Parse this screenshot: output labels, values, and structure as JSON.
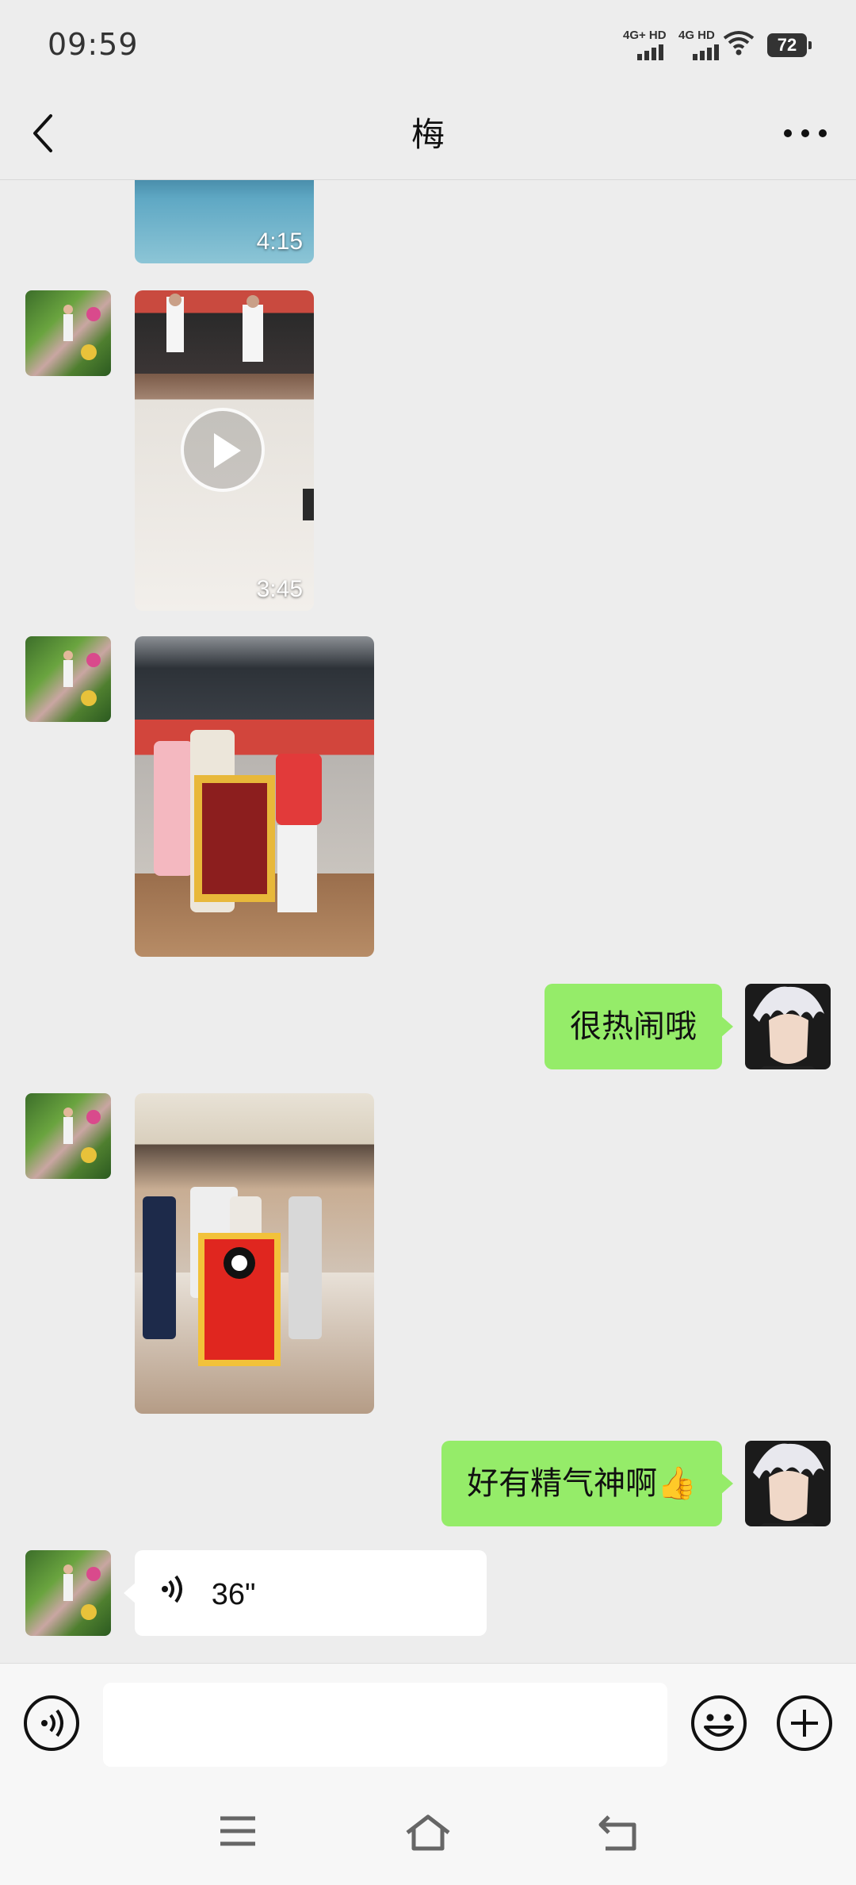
{
  "status_bar": {
    "time": "09:59",
    "signal_1": "4G+ HD",
    "signal_2": "4G HD",
    "battery": "72"
  },
  "header": {
    "title": "梅",
    "back_icon": "chevron-left-icon",
    "more_icon": "more-dots-icon"
  },
  "messages": [
    {
      "sender": "other",
      "type": "video",
      "duration": "4:15"
    },
    {
      "sender": "other",
      "type": "video",
      "duration": "3:45"
    },
    {
      "sender": "other",
      "type": "image"
    },
    {
      "sender": "self",
      "type": "text",
      "text": "很热闹哦"
    },
    {
      "sender": "other",
      "type": "image"
    },
    {
      "sender": "self",
      "type": "text",
      "text": "好有精气神啊👍"
    },
    {
      "sender": "other",
      "type": "voice",
      "duration": "36\""
    }
  ],
  "input_bar": {
    "voice_icon": "voice-mode-icon",
    "emoji_icon": "emoji-icon",
    "plus_icon": "plus-icon",
    "value": ""
  },
  "nav_bar": {
    "menu_icon": "menu-icon",
    "home_icon": "home-icon",
    "back_icon": "back-icon"
  },
  "colors": {
    "background": "#ededed",
    "self_bubble": "#95ec69",
    "other_bubble": "#ffffff"
  }
}
